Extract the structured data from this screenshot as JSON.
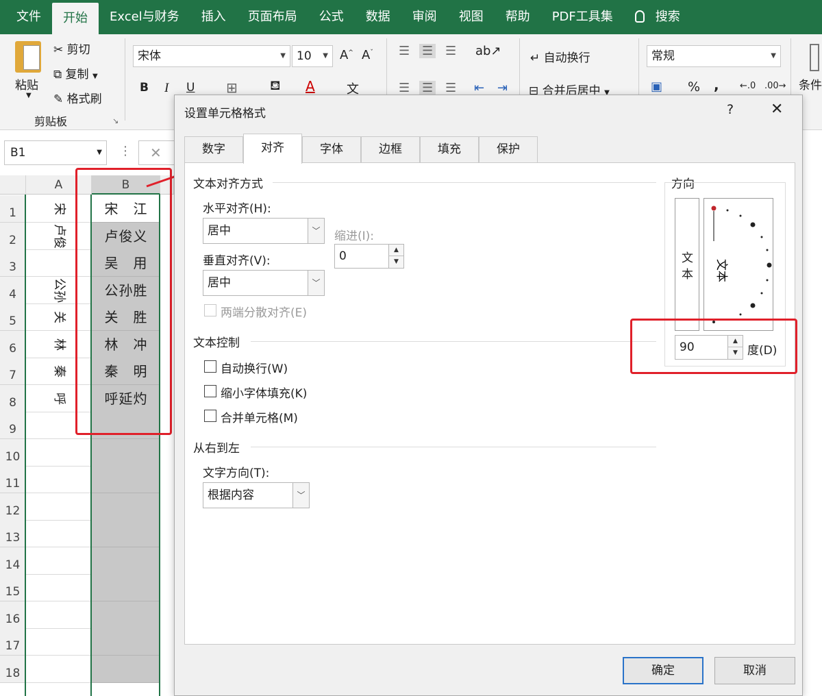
{
  "ribbon_tabs": [
    "文件",
    "开始",
    "Excel与财务",
    "插入",
    "页面布局",
    "公式",
    "数据",
    "审阅",
    "视图",
    "帮助",
    "PDF工具集",
    "搜索"
  ],
  "ribbon": {
    "paste": "粘贴",
    "cut": "剪切",
    "copy": "复制",
    "format_painter": "格式刷",
    "clipboard_group": "剪贴板",
    "font_name": "宋体",
    "font_size": "10",
    "bold": "B",
    "italic": "I",
    "underline": "U",
    "wrap_text": "自动换行",
    "merge_center": "合并后居中",
    "number_format": "常规",
    "percent": "%",
    "comma": ",",
    "conditional": "条件"
  },
  "formula_bar": {
    "name_box": "B1"
  },
  "sheet": {
    "columns": [
      "A",
      "B"
    ],
    "rows": [
      "1",
      "2",
      "3",
      "4",
      "5",
      "6",
      "7",
      "8",
      "9",
      "10",
      "11",
      "12",
      "13",
      "14",
      "15",
      "16",
      "17",
      "18"
    ],
    "col_a_rotated": [
      "宋",
      "卢俊",
      "公孙",
      "关",
      "林",
      "秦",
      "呼"
    ],
    "col_b": [
      "宋　江",
      "卢俊义",
      "吴　用",
      "公孙胜",
      "关　胜",
      "林　冲",
      "秦　明",
      "呼延灼"
    ]
  },
  "dialog": {
    "title": "设置单元格格式",
    "help": "?",
    "close": "✕",
    "tabs": [
      "数字",
      "对齐",
      "字体",
      "边框",
      "填充",
      "保护"
    ],
    "active_tab": "对齐",
    "text_alignment_section": "文本对齐方式",
    "horizontal_label": "水平对齐(H):",
    "horizontal_value": "居中",
    "indent_label": "缩进(I):",
    "indent_value": "0",
    "vertical_label": "垂直对齐(V):",
    "vertical_value": "居中",
    "distributed_label": "两端分散对齐(E)",
    "text_control_section": "文本控制",
    "wrap_label": "自动换行(W)",
    "shrink_label": "缩小字体填充(K)",
    "merge_label": "合并单元格(M)",
    "rtl_section": "从右到左",
    "direction_label": "文字方向(T):",
    "direction_value": "根据内容",
    "orientation_section": "方向",
    "orientation_vertical_text": [
      "文",
      "本"
    ],
    "orientation_dial_text": "文本",
    "degrees_value": "90",
    "degrees_label": "度(D)",
    "ok": "确定",
    "cancel": "取消"
  },
  "colors": {
    "ribbon_green": "#217346",
    "highlight_red": "#e0202a",
    "ok_border": "#2a73c9"
  }
}
